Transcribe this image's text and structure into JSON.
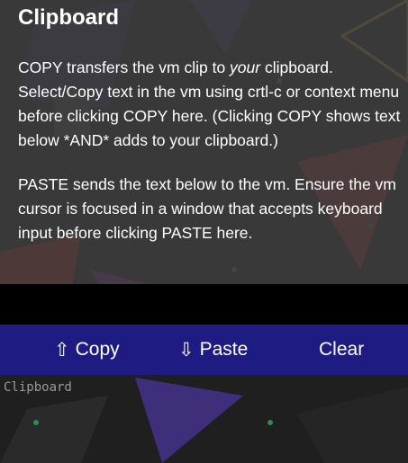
{
  "colors": {
    "toolbar": "#1e1b82",
    "text": "#ffffff",
    "placeholder": "#9a9a9a",
    "overlay": "rgba(62,62,62,0.86)"
  },
  "title": "Clipboard",
  "copy_paragraph": {
    "before_em": "COPY transfers the vm clip to ",
    "em": "your",
    "after_em": " clipboard. Select/Copy text in the vm using crtl-c or context menu before clicking COPY here. (Clicking COPY shows text below *AND* adds to your clipboard.)"
  },
  "paste_paragraph": "PASTE sends the text below to the vm. Ensure the vm cursor is focused in a window that accepts keyboard input before clicking PASTE here.",
  "toolbar": {
    "copy": {
      "icon": "upload-arrow-icon",
      "glyph": "⇧",
      "label": "Copy"
    },
    "paste": {
      "icon": "download-arrow-icon",
      "glyph": "⇩",
      "label": "Paste"
    },
    "clear": {
      "label": "Clear"
    }
  },
  "clipboard_text": {
    "value": "",
    "placeholder": "Clipboard"
  }
}
